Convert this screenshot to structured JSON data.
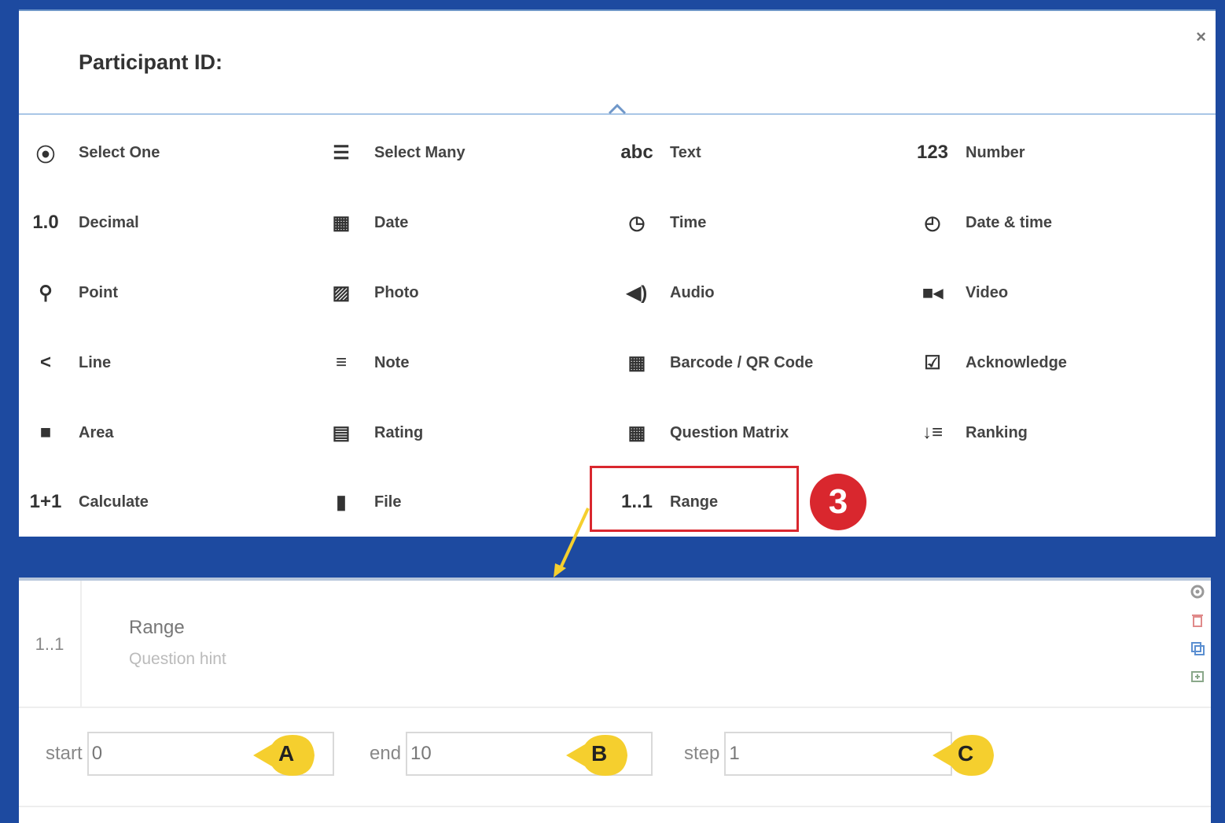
{
  "picker": {
    "title": "Participant ID:",
    "close_label": "×",
    "items": [
      {
        "label": "Select One",
        "icon": "radio-icon",
        "glyph": "⦿"
      },
      {
        "label": "Select Many",
        "icon": "list-icon",
        "glyph": "☰"
      },
      {
        "label": "Text",
        "icon": "abc-icon",
        "glyph": "abc"
      },
      {
        "label": "Number",
        "icon": "123-icon",
        "glyph": "123"
      },
      {
        "label": "Decimal",
        "icon": "decimal-icon",
        "glyph": "1.0"
      },
      {
        "label": "Date",
        "icon": "calendar-icon",
        "glyph": "▦"
      },
      {
        "label": "Time",
        "icon": "clock-icon",
        "glyph": "◷"
      },
      {
        "label": "Date & time",
        "icon": "date-time-icon",
        "glyph": "◴"
      },
      {
        "label": "Point",
        "icon": "map-pin-icon",
        "glyph": "⚲"
      },
      {
        "label": "Photo",
        "icon": "photo-icon",
        "glyph": "▨"
      },
      {
        "label": "Audio",
        "icon": "speaker-icon",
        "glyph": "◀)"
      },
      {
        "label": "Video",
        "icon": "video-icon",
        "glyph": "■◂"
      },
      {
        "label": "Line",
        "icon": "share-icon",
        "glyph": "<"
      },
      {
        "label": "Note",
        "icon": "note-icon",
        "glyph": "≡"
      },
      {
        "label": "Barcode / QR Code",
        "icon": "barcode-icon",
        "glyph": "▦"
      },
      {
        "label": "Acknowledge",
        "icon": "checkbox-icon",
        "glyph": "☑"
      },
      {
        "label": "Area",
        "icon": "area-icon",
        "glyph": "■"
      },
      {
        "label": "Rating",
        "icon": "rating-icon",
        "glyph": "▤"
      },
      {
        "label": "Question Matrix",
        "icon": "matrix-icon",
        "glyph": "▦"
      },
      {
        "label": "Ranking",
        "icon": "ranking-icon",
        "glyph": "↓≡"
      },
      {
        "label": "Calculate",
        "icon": "calculate-icon",
        "glyph": "1+1"
      },
      {
        "label": "File",
        "icon": "file-icon",
        "glyph": "▮"
      },
      {
        "label": "Range",
        "icon": "range-icon",
        "glyph": "1..1"
      }
    ],
    "step_number": "3"
  },
  "card": {
    "type_glyph": "1..1",
    "name": "Range",
    "hint": "Question hint",
    "params": [
      {
        "label": "start",
        "value": "0",
        "callout": "A"
      },
      {
        "label": "end",
        "value": "10",
        "callout": "B"
      },
      {
        "label": "step",
        "value": "1",
        "callout": "C"
      }
    ]
  },
  "colors": {
    "background": "#1d4aa0",
    "highlight": "#d9272e",
    "callout": "#f5cf2e"
  }
}
